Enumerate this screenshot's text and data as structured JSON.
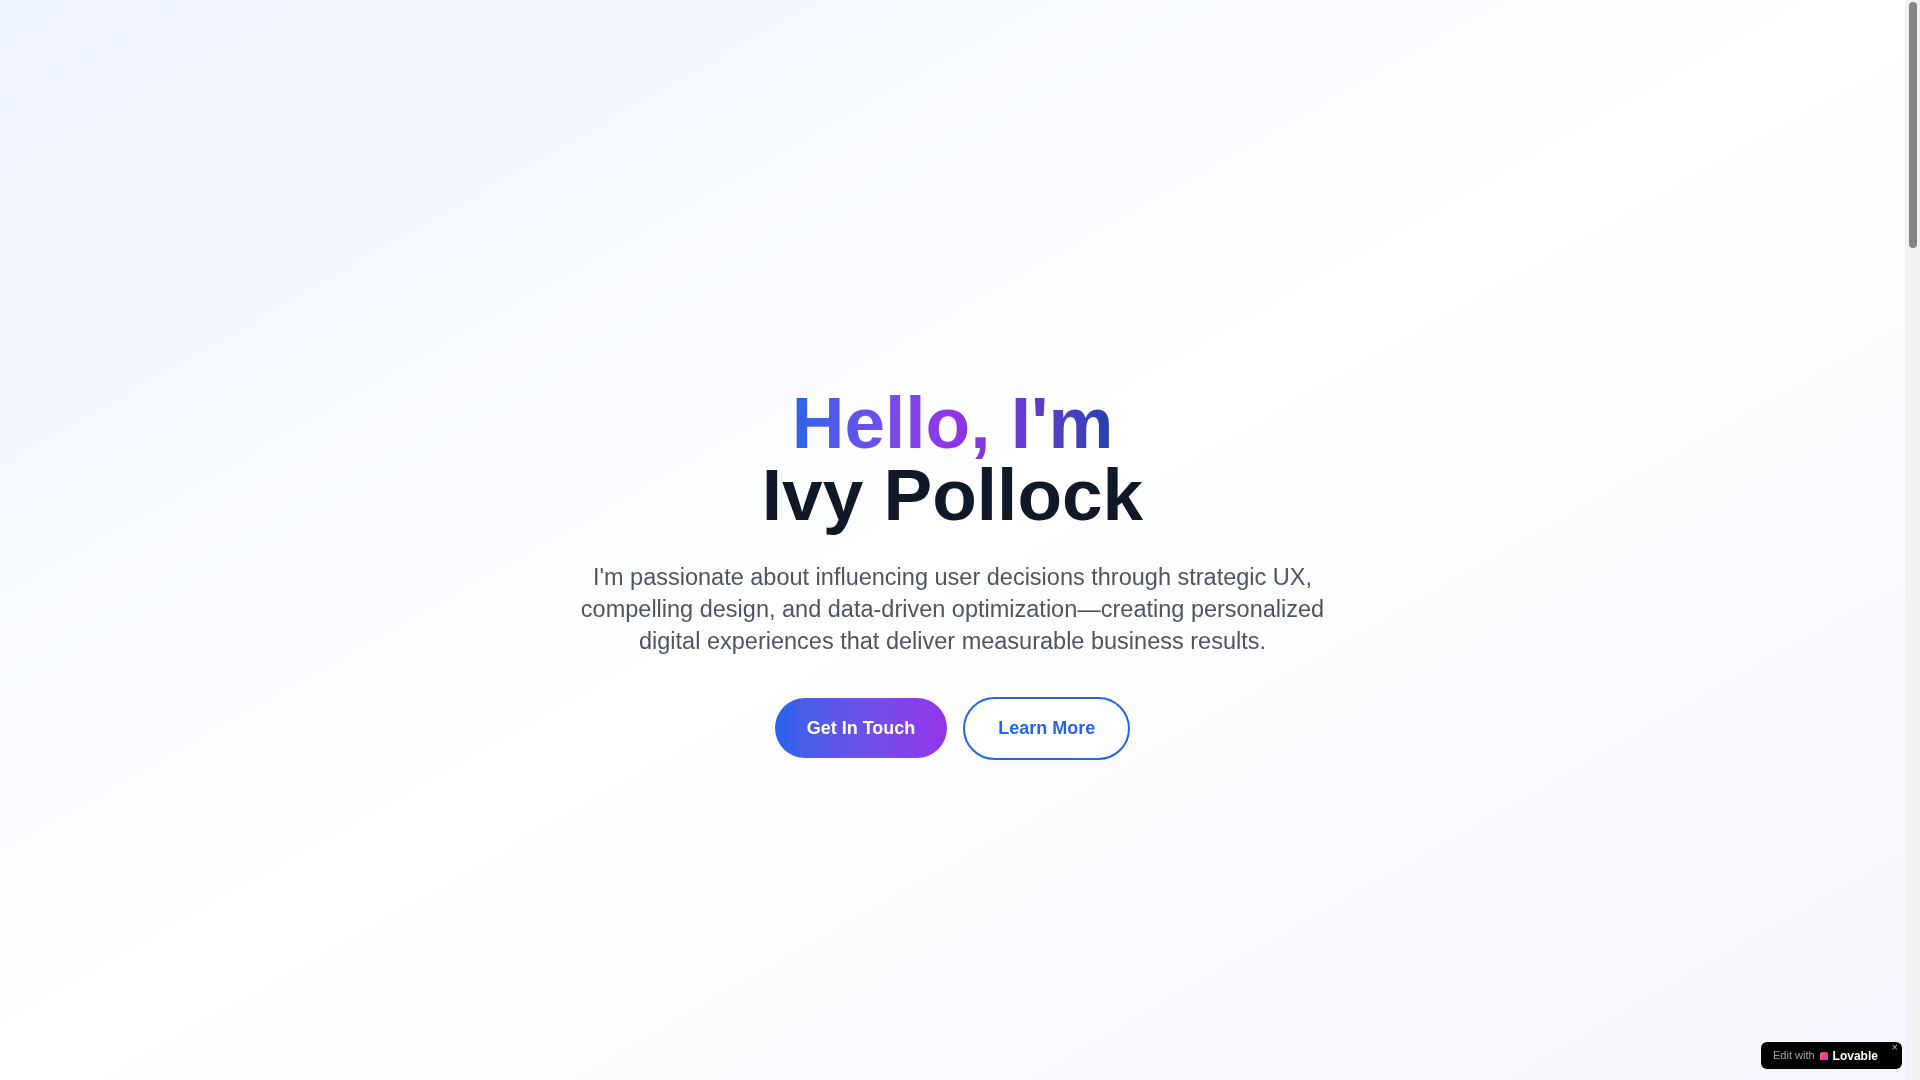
{
  "hero": {
    "greeting": "Hello, I'm",
    "name": "Ivy Pollock",
    "intro": "I'm passionate about influencing user decisions through strategic UX, compelling design, and data-driven optimization—creating personalized digital experiences that deliver measurable business results.",
    "buttons": [
      {
        "label": "Get In Touch",
        "kind": "primary"
      },
      {
        "label": "Learn More",
        "kind": "outline"
      }
    ]
  },
  "badge": {
    "prefix": "Edit with",
    "brand": "Lovable",
    "close": "×"
  }
}
